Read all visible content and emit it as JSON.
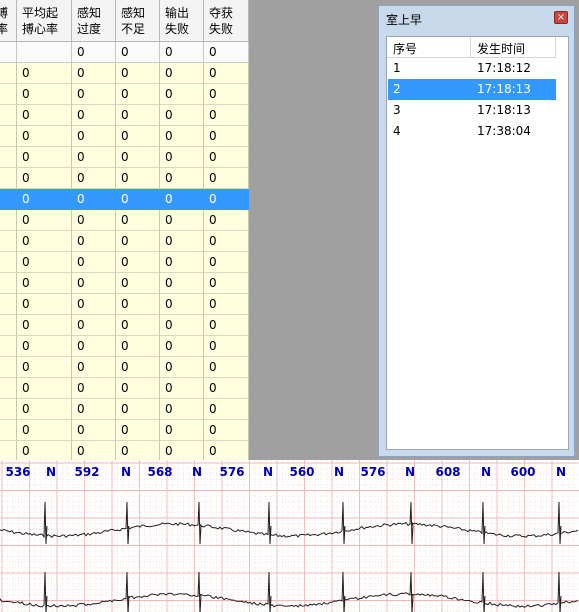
{
  "table": {
    "headers": [
      {
        "l1": "搏",
        "l2": "率"
      },
      {
        "l1": "平均起",
        "l2": "搏心率"
      },
      {
        "l1": "感知",
        "l2": "过度"
      },
      {
        "l1": "感知",
        "l2": "不足"
      },
      {
        "l1": "输出",
        "l2": "失败"
      },
      {
        "l1": "夺获",
        "l2": "失败"
      }
    ],
    "totals": [
      "",
      "",
      "0",
      "0",
      "0",
      "0"
    ],
    "rows": [
      [
        "",
        "0",
        "0",
        "0",
        "0",
        "0"
      ],
      [
        "",
        "0",
        "0",
        "0",
        "0",
        "0"
      ],
      [
        "",
        "0",
        "0",
        "0",
        "0",
        "0"
      ],
      [
        "",
        "0",
        "0",
        "0",
        "0",
        "0"
      ],
      [
        "",
        "0",
        "0",
        "0",
        "0",
        "0"
      ],
      [
        "",
        "0",
        "0",
        "0",
        "0",
        "0"
      ],
      [
        "",
        "0",
        "0",
        "0",
        "0",
        "0"
      ],
      [
        "",
        "0",
        "0",
        "0",
        "0",
        "0"
      ],
      [
        "",
        "0",
        "0",
        "0",
        "0",
        "0"
      ],
      [
        "",
        "0",
        "0",
        "0",
        "0",
        "0"
      ],
      [
        "",
        "0",
        "0",
        "0",
        "0",
        "0"
      ],
      [
        "",
        "0",
        "0",
        "0",
        "0",
        "0"
      ],
      [
        "",
        "0",
        "0",
        "0",
        "0",
        "0"
      ],
      [
        "",
        "0",
        "0",
        "0",
        "0",
        "0"
      ],
      [
        "",
        "0",
        "0",
        "0",
        "0",
        "0"
      ],
      [
        "",
        "0",
        "0",
        "0",
        "0",
        "0"
      ],
      [
        "",
        "0",
        "0",
        "0",
        "0",
        "0"
      ],
      [
        "",
        "0",
        "0",
        "0",
        "0",
        "0"
      ],
      [
        "",
        "0",
        "0",
        "0",
        "0",
        "0"
      ]
    ],
    "selected_row": 6
  },
  "panel": {
    "title": "室上早",
    "close": "×",
    "columns": [
      "序号",
      "发生时间"
    ],
    "items": [
      {
        "no": "1",
        "time": "17:18:12"
      },
      {
        "no": "2",
        "time": "17:18:13"
      },
      {
        "no": "3",
        "time": "17:18:13"
      },
      {
        "no": "4",
        "time": "17:38:04"
      }
    ],
    "selected_item": 1
  },
  "ecg": {
    "labels": [
      "536",
      "N",
      "592",
      "N",
      "568",
      "N",
      "576",
      "N",
      "560",
      "N",
      "576",
      "N",
      "608",
      "N",
      "600",
      "N"
    ],
    "label_color": "#0000b4",
    "grid_color": "#f0b8b8",
    "trace_color": "#202020"
  }
}
